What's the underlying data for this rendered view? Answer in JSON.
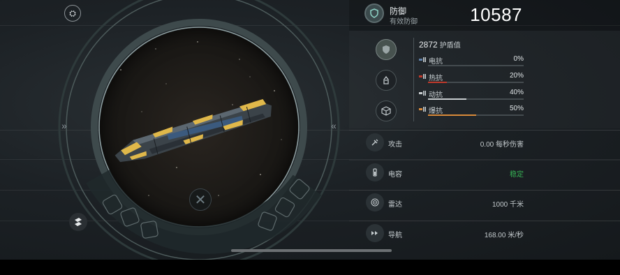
{
  "viewer": {
    "top_icon": "inventory-icon",
    "logo_icon": "game-logo-icon",
    "left_chevron": "»",
    "right_chevron": "«",
    "close_glyph": "✕"
  },
  "defense": {
    "title": "防御",
    "subtitle": "有效防御",
    "value": "10587",
    "icon": "shield-icon"
  },
  "shield": {
    "value": "2872",
    "label": "护盾值",
    "resistances": [
      {
        "label": "电抗",
        "percent_text": "0%",
        "fill": 0.0,
        "color": "#5f7fa8"
      },
      {
        "label": "热抗",
        "percent_text": "20%",
        "fill": 0.2,
        "color": "#c0392b"
      },
      {
        "label": "动抗",
        "percent_text": "40%",
        "fill": 0.4,
        "color": "#c8cdd0"
      },
      {
        "label": "爆抗",
        "percent_text": "50%",
        "fill": 0.5,
        "color": "#d98a3a"
      }
    ]
  },
  "stats": [
    {
      "icon": "attack-icon",
      "label": "攻击",
      "value": "0.00 每秒伤害"
    },
    {
      "icon": "capacitor-icon",
      "label": "电容",
      "value": "稳定"
    },
    {
      "icon": "radar-icon",
      "label": "雷达",
      "value": "1000 千米"
    },
    {
      "icon": "navigation-icon",
      "label": "导航",
      "value": "168.00 米/秒"
    }
  ]
}
